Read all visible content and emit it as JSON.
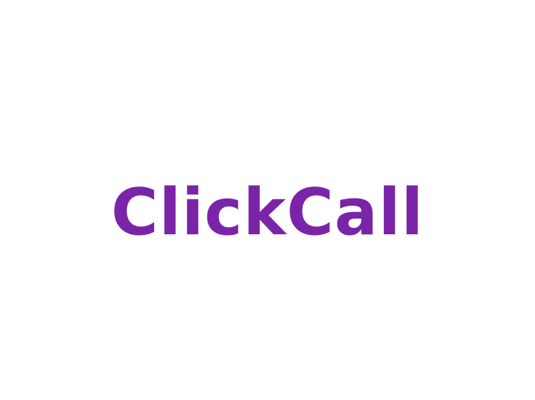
{
  "logo": {
    "text": "ClickCall",
    "color": "#7a24a8"
  },
  "background_color": "#ffffff"
}
